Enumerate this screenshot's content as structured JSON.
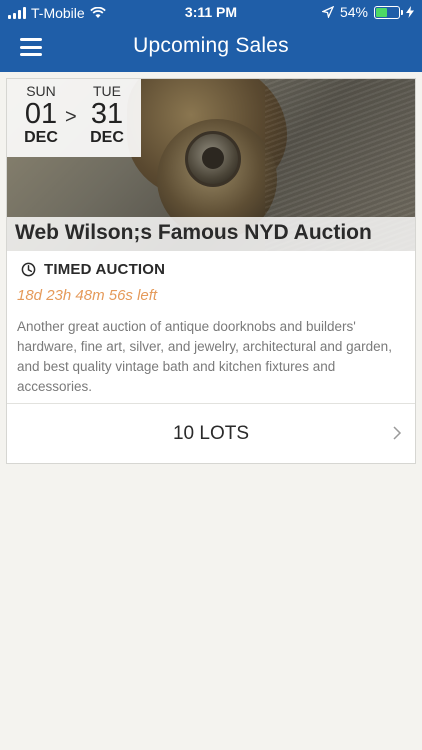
{
  "status_bar": {
    "carrier": "T-Mobile",
    "time": "3:11 PM",
    "battery": "54%",
    "battery_level": 0.54,
    "icons": [
      "signal-icon",
      "wifi-icon",
      "location-icon",
      "battery-icon",
      "charging-icon"
    ]
  },
  "nav": {
    "title": "Upcoming Sales",
    "menu_icon": "hamburger-icon"
  },
  "sale": {
    "start": {
      "dow": "SUN",
      "day": "01",
      "month": "DEC"
    },
    "separator": ">",
    "end": {
      "dow": "TUE",
      "day": "31",
      "month": "DEC"
    },
    "title": "Web Wilson;s Famous NYD Auction",
    "type": "TIMED AUCTION",
    "countdown": "18d 23h 48m 56s left",
    "description": "Another great auction of antique doorknobs and builders' hardware, fine art, silver, and jewelry, architectural and garden, and best quality vintage bath and kitchen fixtures and accessories.",
    "lots_label": "10 LOTS"
  },
  "colors": {
    "header": "#1f5ea8",
    "background": "#f4f3ef",
    "countdown": "#e59a5a"
  }
}
